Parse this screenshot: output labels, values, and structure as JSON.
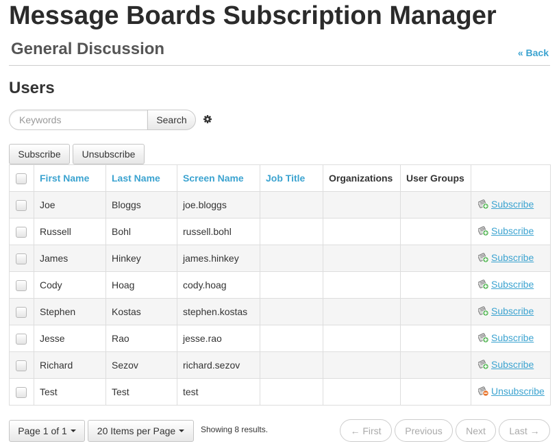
{
  "header": {
    "title": "Message Boards Subscription Manager",
    "subtitle": "General Discussion",
    "back_label": "« Back"
  },
  "section_title": "Users",
  "search": {
    "placeholder": "Keywords",
    "value": "",
    "button_label": "Search"
  },
  "toolbar": {
    "subscribe_label": "Subscribe",
    "unsubscribe_label": "Unsubscribe"
  },
  "table": {
    "columns": [
      "First Name",
      "Last Name",
      "Screen Name",
      "Job Title",
      "Organizations",
      "User Groups"
    ],
    "rows": [
      {
        "first": "Joe",
        "last": "Bloggs",
        "screen": "joe.bloggs",
        "job": "",
        "orgs": "",
        "groups": "",
        "action": "Subscribe",
        "action_icon": "subscribe-icon"
      },
      {
        "first": "Russell",
        "last": "Bohl",
        "screen": "russell.bohl",
        "job": "",
        "orgs": "",
        "groups": "",
        "action": "Subscribe",
        "action_icon": "subscribe-icon"
      },
      {
        "first": "James",
        "last": "Hinkey",
        "screen": "james.hinkey",
        "job": "",
        "orgs": "",
        "groups": "",
        "action": "Subscribe",
        "action_icon": "subscribe-icon"
      },
      {
        "first": "Cody",
        "last": "Hoag",
        "screen": "cody.hoag",
        "job": "",
        "orgs": "",
        "groups": "",
        "action": "Subscribe",
        "action_icon": "subscribe-icon"
      },
      {
        "first": "Stephen",
        "last": "Kostas",
        "screen": "stephen.kostas",
        "job": "",
        "orgs": "",
        "groups": "",
        "action": "Subscribe",
        "action_icon": "subscribe-icon"
      },
      {
        "first": "Jesse",
        "last": "Rao",
        "screen": "jesse.rao",
        "job": "",
        "orgs": "",
        "groups": "",
        "action": "Subscribe",
        "action_icon": "subscribe-icon"
      },
      {
        "first": "Richard",
        "last": "Sezov",
        "screen": "richard.sezov",
        "job": "",
        "orgs": "",
        "groups": "",
        "action": "Subscribe",
        "action_icon": "subscribe-icon"
      },
      {
        "first": "Test",
        "last": "Test",
        "screen": "test",
        "job": "",
        "orgs": "",
        "groups": "",
        "action": "Unsubscribe",
        "action_icon": "unsubscribe-icon"
      }
    ]
  },
  "pagination": {
    "page_label": "Page 1 of 1",
    "items_label": "20 Items per Page",
    "results_text": "Showing 8 results.",
    "first_label": "← First",
    "previous_label": "Previous",
    "next_label": "Next",
    "last_label": "Last →"
  },
  "colors": {
    "link": "#3ba3d0",
    "title": "#2b2b2b",
    "subscribe_badge": "#5cb85c",
    "unsubscribe_badge": "#e8742c"
  },
  "icons": {
    "settings": "gear-icon",
    "subscribe": "subscribe-icon",
    "unsubscribe": "unsubscribe-icon"
  }
}
